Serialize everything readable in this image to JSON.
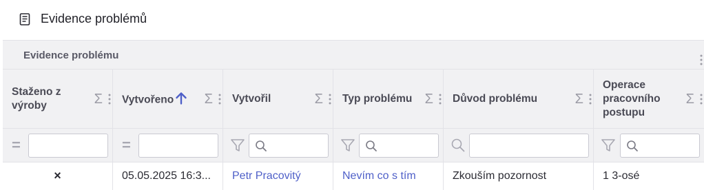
{
  "page": {
    "title": "Evidence problémů"
  },
  "grid": {
    "group_title": "Evidence problému",
    "columns": [
      {
        "label": "Staženo z výroby"
      },
      {
        "label": "Vytvořeno"
      },
      {
        "label": "Vytvořil"
      },
      {
        "label": "Typ problému"
      },
      {
        "label": "Důvod problému"
      },
      {
        "label": "Operace pracovního postupu"
      }
    ],
    "sum_symbol": "Σ",
    "eq_symbol": "=",
    "filters": [
      {
        "value": "",
        "placeholder": ""
      },
      {
        "value": "",
        "placeholder": ""
      },
      {
        "value": "",
        "placeholder": ""
      },
      {
        "value": "",
        "placeholder": ""
      },
      {
        "value": "",
        "placeholder": ""
      },
      {
        "value": "",
        "placeholder": ""
      }
    ],
    "rows": [
      {
        "withdrawn": "×",
        "created": "05.05.2025 16:3...",
        "created_by": "Petr Pracovitý",
        "problem_type": "Nevím co s tím",
        "problem_reason": "Zkouším pozornost",
        "operation": "1 3-osé"
      }
    ]
  },
  "colors": {
    "accent": "#4e5fc8",
    "header_bg": "#f1f1f3",
    "border": "#e2e2e7"
  }
}
